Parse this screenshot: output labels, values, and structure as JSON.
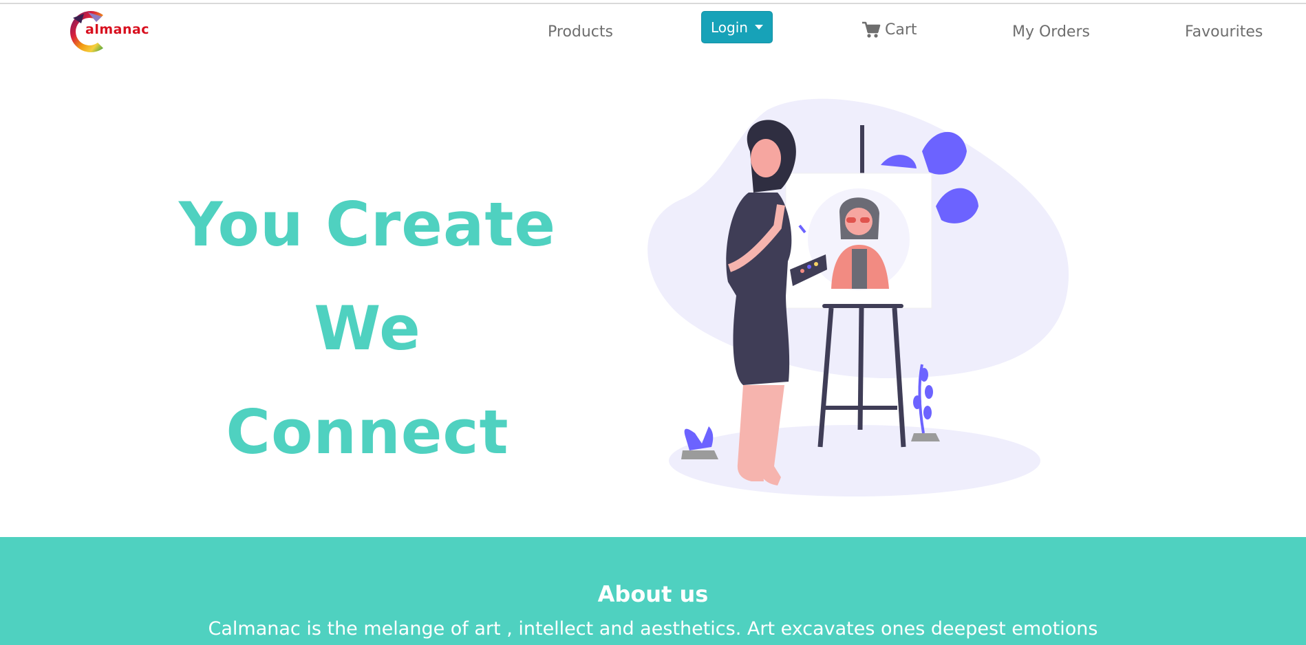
{
  "brand": {
    "logo_text": "almanac",
    "accent": "#4fd1c0",
    "button_color": "#17a2b8"
  },
  "nav": {
    "products": "Products",
    "login": "Login",
    "cart": "Cart",
    "orders": "My Orders",
    "favourites": "Favourites",
    "icons": {
      "cart": "cart-icon",
      "login_caret": "chevron-down-icon"
    }
  },
  "hero": {
    "line1": "You Create",
    "line2": "We",
    "line3": "Connect"
  },
  "about": {
    "title": "About us",
    "text": "Calmanac is the melange of art , intellect and aesthetics. Art excavates ones deepest emotions"
  }
}
